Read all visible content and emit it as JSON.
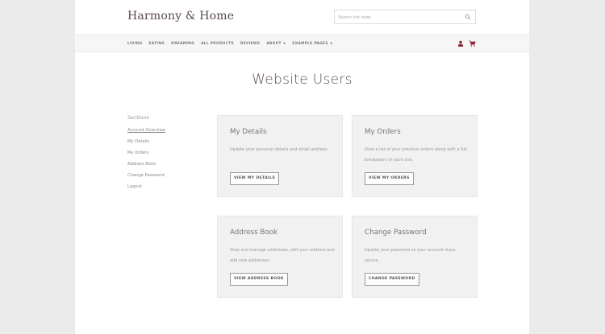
{
  "header": {
    "logo": "Harmony & Home",
    "search": {
      "placeholder": "Search the shop"
    }
  },
  "nav": {
    "items": [
      {
        "label": "LIVING"
      },
      {
        "label": "EATING"
      },
      {
        "label": "DREAMING"
      },
      {
        "label": "ALL PRODUCTS"
      },
      {
        "label": "REVIEWS"
      },
      {
        "label": "ABOUT",
        "has_dropdown": true
      },
      {
        "label": "EXAMPLE PAGES",
        "has_dropdown": true
      }
    ],
    "icons": [
      "user-icon",
      "cart-icon"
    ]
  },
  "main": {
    "title": "Website Users"
  },
  "sidebar": {
    "heading": "Sections",
    "items": [
      {
        "label": "Account Overview",
        "active": true
      },
      {
        "label": "My Details"
      },
      {
        "label": "My Orders"
      },
      {
        "label": "Address Book"
      },
      {
        "label": "Change Password"
      },
      {
        "label": "Logout"
      }
    ]
  },
  "cards": [
    {
      "title": "My Details",
      "text": "Update your personal details and email address.",
      "button": "VIEW MY DETAILS"
    },
    {
      "title": "My Orders",
      "text": "View a list of your previous orders along with a full breakdown of each one.",
      "button": "VIEW MY ORDERS"
    },
    {
      "title": "Address Book",
      "text": "View and manage addresses, edit your address and add new addresses.",
      "button": "VIEW ADDRESS BOOK"
    },
    {
      "title": "Change Password",
      "text": "Update your password so your account stays secure.",
      "button": "CHANGE PASSWORD"
    }
  ],
  "colors": {
    "brand": "#5a4a4a",
    "accent": "#8b2a3a",
    "card_bg": "#f1f1f1",
    "page_bg": "#ebebeb"
  }
}
